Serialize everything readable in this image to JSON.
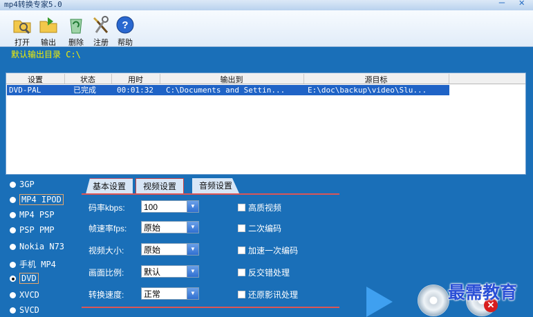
{
  "window": {
    "title": "mp4转换专家5.0",
    "controls": "— ✕"
  },
  "toolbar": {
    "open_label": "打开",
    "output_label": "输出",
    "delete_label": "删除",
    "register_label": "注册",
    "help_label": "帮助"
  },
  "default_output": "默认输出目录 C:\\",
  "table": {
    "columns": [
      "设置",
      "状态",
      "用时",
      "输出到",
      "源目标"
    ],
    "rows": [
      [
        "DVD-PAL",
        "已完成",
        "00:01:32",
        "C:\\Documents and Settin...",
        "E:\\doc\\backup\\video\\Slu..."
      ]
    ]
  },
  "formats": [
    {
      "label": "3GP"
    },
    {
      "label": "MP4 IPOD"
    },
    {
      "label": "MP4 PSP"
    },
    {
      "label": "PSP PMP"
    },
    {
      "label": "Nokia N73"
    },
    {
      "label": "手机 MP4"
    },
    {
      "label": "DVD"
    },
    {
      "label": "XVCD"
    },
    {
      "label": "SVCD"
    }
  ],
  "selected_format": "DVD",
  "tabs": {
    "basic": "基本设置",
    "video": "视频设置",
    "audio": "音频设置"
  },
  "video_settings": {
    "bitrate_label": "码率kbps:",
    "bitrate_value": "100",
    "framerate_label": "帧速率fps:",
    "framerate_value": "原始",
    "size_label": "视频大小:",
    "size_value": "原始",
    "aspect_label": "画面比例:",
    "aspect_value": "默认",
    "speed_label": "转换速度:",
    "speed_value": "正常"
  },
  "options": {
    "hq": "高质视频",
    "two_pass": "二次编码",
    "fast_pass": "加速一次编码",
    "deinterlace": "反交错处理",
    "restore": "还原影讯处理"
  },
  "watermark": "最需教育",
  "colors": {
    "background": "#1a6fb8",
    "selected_row": "#1f63c6",
    "default_output_text": "#f5f000",
    "tab_accent": "#dd5555"
  }
}
